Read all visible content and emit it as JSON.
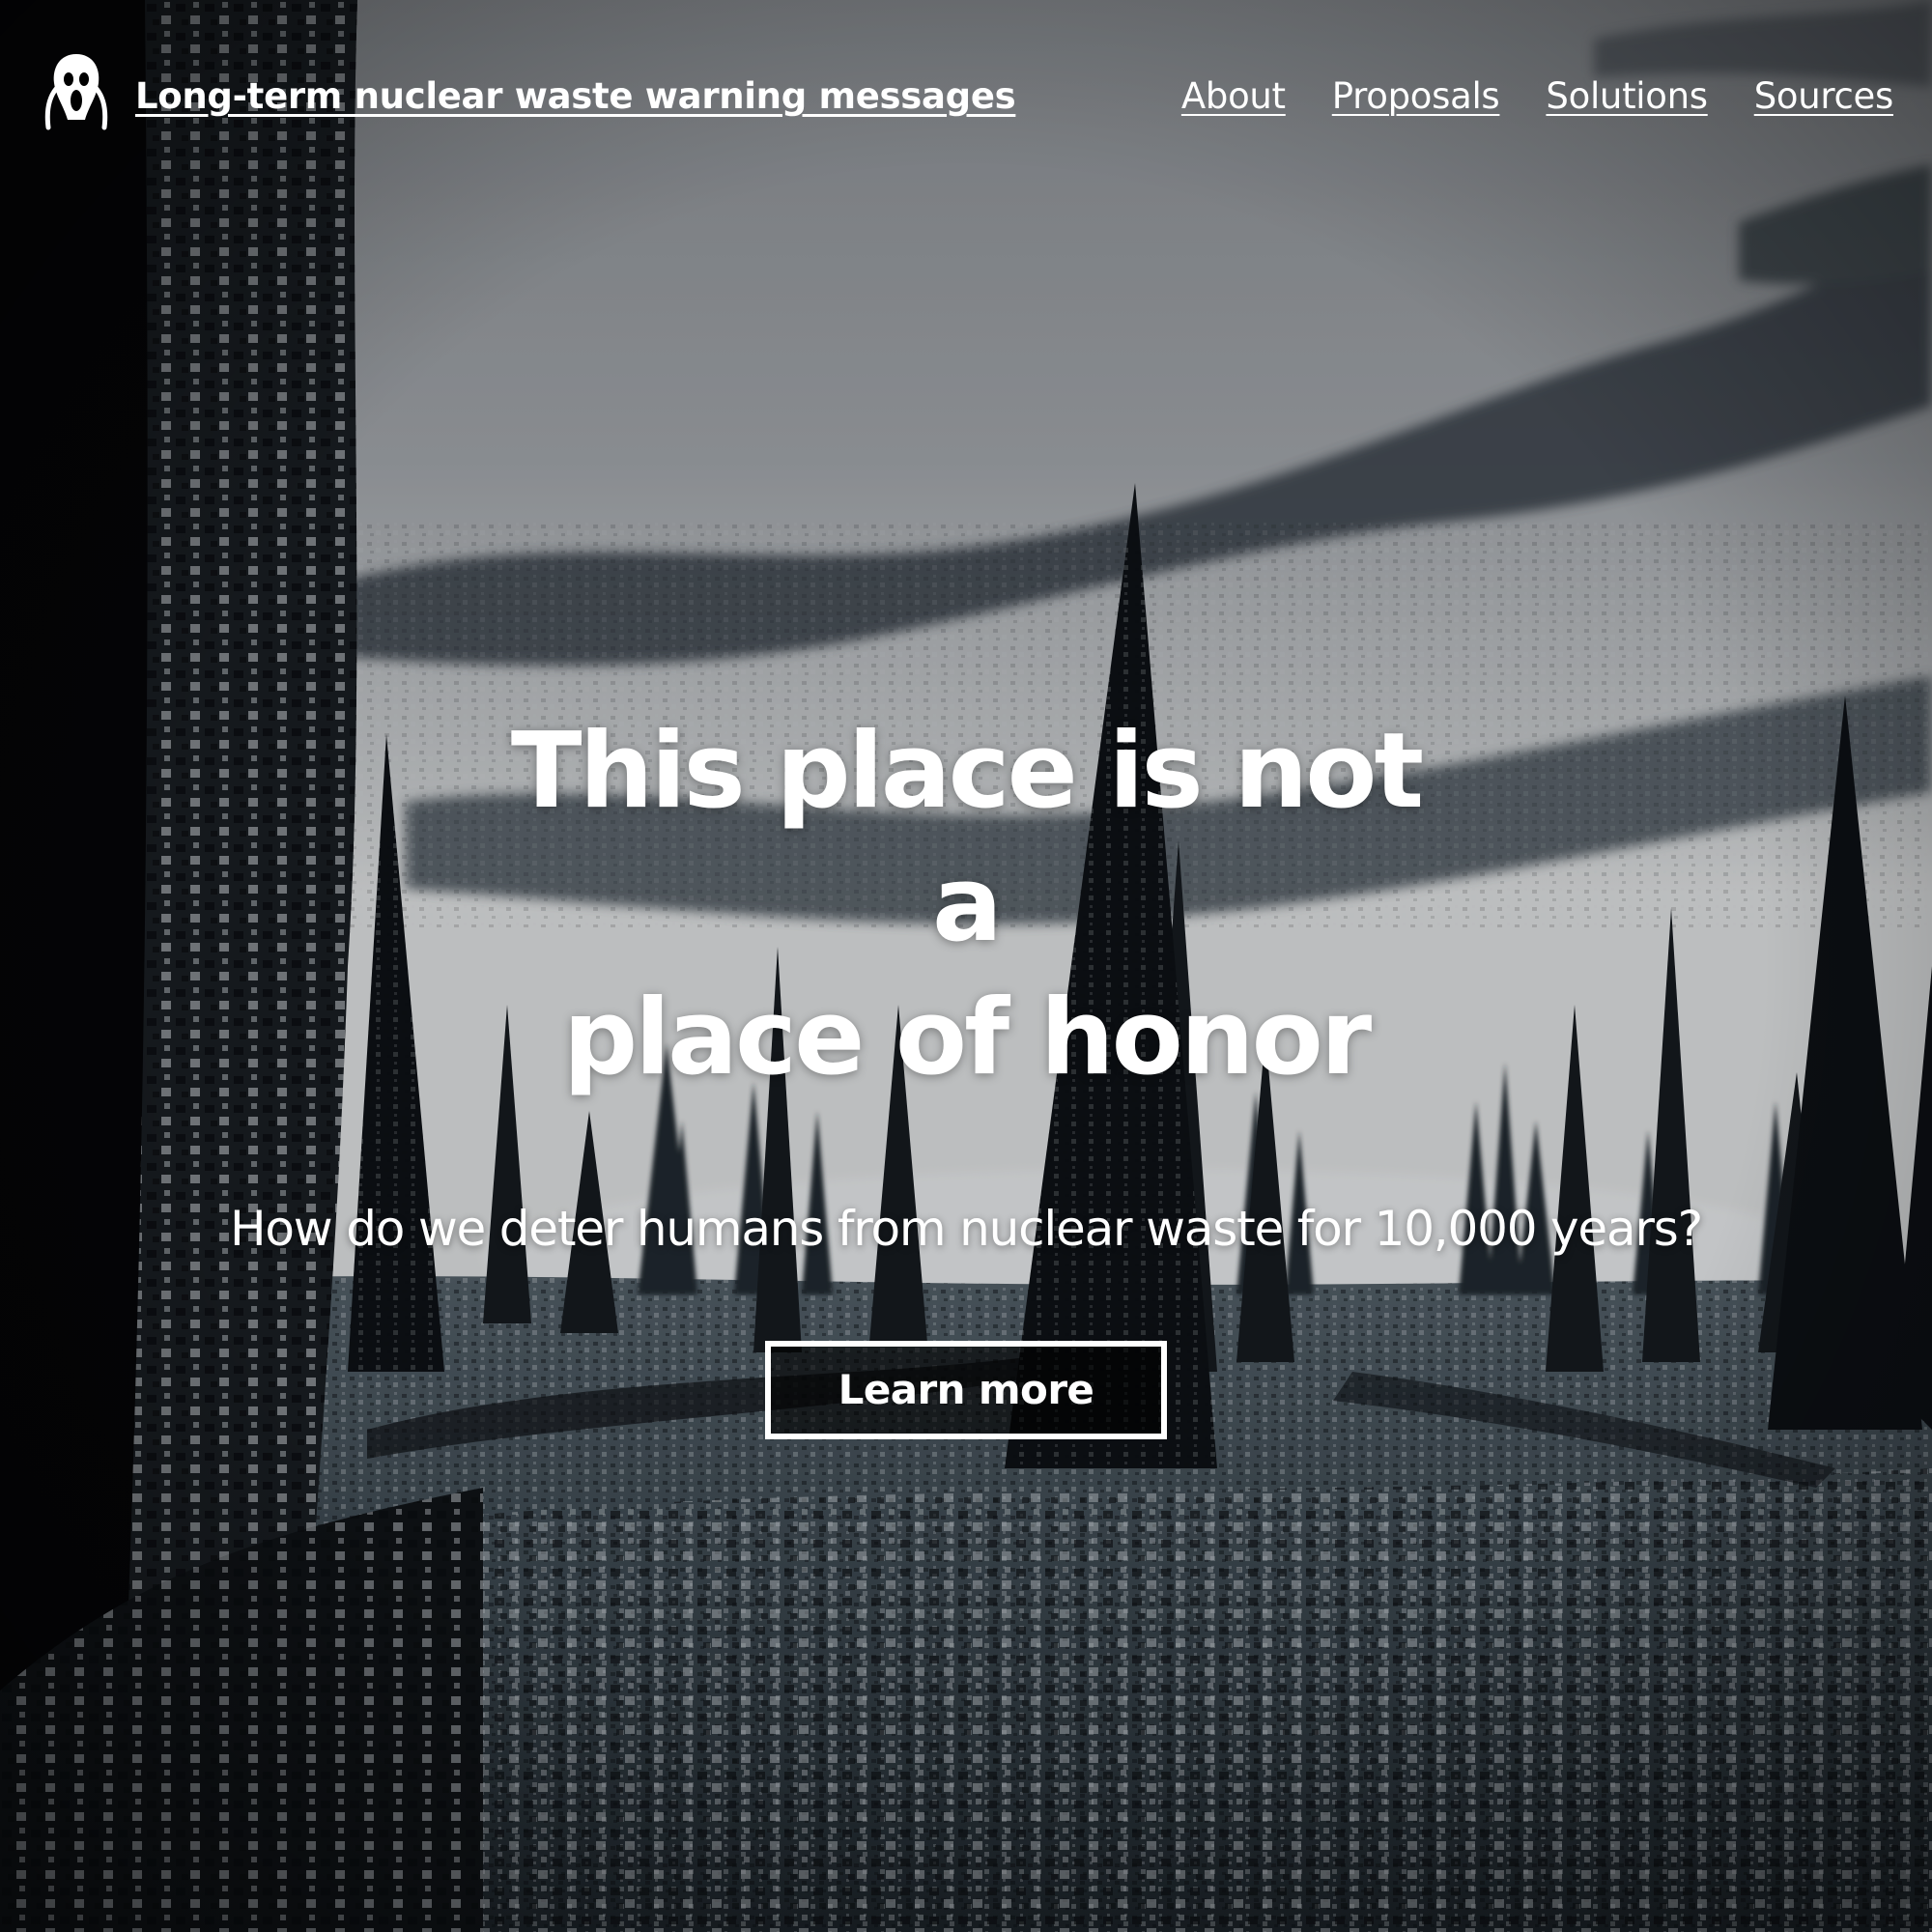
{
  "header": {
    "logo_icon": "screaming-face-icon",
    "site_title": "Long-term nuclear waste warning messages",
    "nav": [
      {
        "label": "About"
      },
      {
        "label": "Proposals"
      },
      {
        "label": "Solutions"
      },
      {
        "label": "Sources"
      }
    ]
  },
  "hero": {
    "headline_line1": "This place is not a",
    "headline_line2": "place of honor",
    "subtitle": "How do we deter humans from nuclear waste for 10,000 years?",
    "cta_label": "Learn more"
  },
  "background": {
    "description_icon": "spiked-landscape-image",
    "sky_color": "#b9bcbf",
    "cloud_color": "#3a4148",
    "ground_color": "#6f7b84",
    "spike_color": "#14181c"
  }
}
